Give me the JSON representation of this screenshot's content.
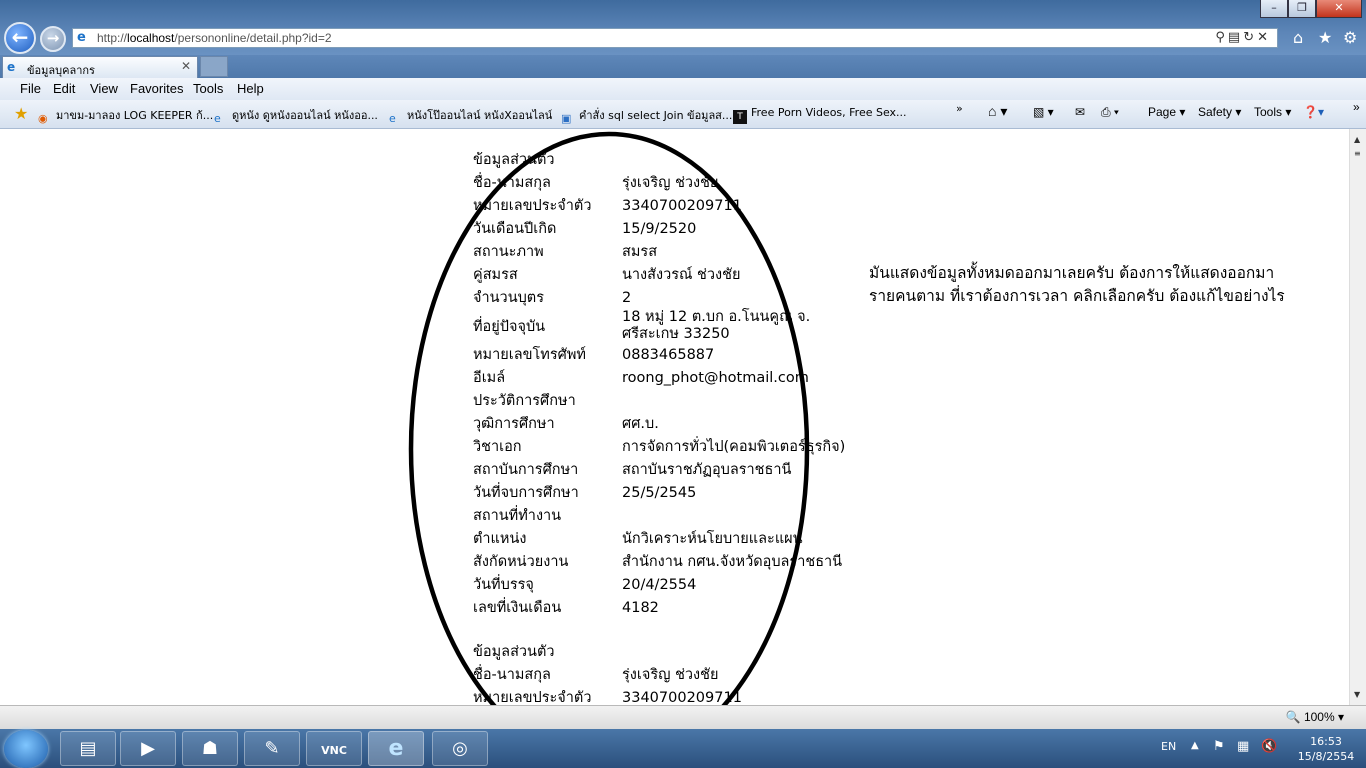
{
  "browser": {
    "url_prefix": "http://",
    "url_host": "localhost",
    "url_path": "/persononline/detail.php?id=2",
    "tab_title": "ข้อมูลบุคลากร",
    "window_controls": [
      "–",
      "❐",
      "✕"
    ]
  },
  "menu": [
    "File",
    "Edit",
    "View",
    "Favorites",
    "Tools",
    "Help"
  ],
  "favorites": [
    "มาขม-มาลอง LOG KEEPER ก้...",
    "ดูหนัง ดูหนังออนไลน์ หนังออ...",
    "หนังโป๊ออนไลน์ หนังXออนไลน์",
    "คำสั่ง sql select Join ข้อมูลส...",
    "Free Porn Videos, Free Sex..."
  ],
  "commands": {
    "page": "Page",
    "safety": "Safety",
    "tools": "Tools"
  },
  "record": [
    {
      "label": "ข้อมูลส่วนตัว",
      "value": ""
    },
    {
      "label": "ชื่อ-นามสกุล",
      "value": "รุ่งเจริญ  ช่วงชัย"
    },
    {
      "label": "หมายเลขประจำตัว",
      "value": "3340700209711"
    },
    {
      "label": "วันเดือนปีเกิด",
      "value": "15/9/2520"
    },
    {
      "label": "สถานะภาพ",
      "value": "สมรส"
    },
    {
      "label": "คู่สมรส",
      "value": "นางสังวรณ์ ช่วงชัย"
    },
    {
      "label": "จำนวนบุตร",
      "value": "2"
    },
    {
      "label": "ที่อยู่ปัจจุบัน",
      "value": "18 หมู่ 12 ต.บก อ.โนนคูณ จ.",
      "value2": "ศรีสะเกษ 33250"
    },
    {
      "label": "หมายเลขโทรศัพท์",
      "value": "0883465887"
    },
    {
      "label": "อีเมล์",
      "value": "roong_phot@hotmail.com"
    },
    {
      "label": "ประวัติการศึกษา",
      "value": ""
    },
    {
      "label": "วุฒิการศึกษา",
      "value": "ศศ.บ."
    },
    {
      "label": "วิชาเอก",
      "value": "การจัดการทั่วไป(คอมพิวเตอร์ธุรกิจ)"
    },
    {
      "label": "สถาบันการศึกษา",
      "value": "สถาบันราชภัฏอุบลราชธานี"
    },
    {
      "label": "วันที่จบการศึกษา",
      "value": "25/5/2545"
    },
    {
      "label": "สถานที่ทำงาน",
      "value": ""
    },
    {
      "label": "ตำแหน่ง",
      "value": "นักวิเคราะห์นโยบายและแผน"
    },
    {
      "label": "สังกัดหน่วยงาน",
      "value": "สำนักงาน กศน.จังหวัดอุบลราชธานี"
    },
    {
      "label": "วันที่บรรจุ",
      "value": "20/4/2554"
    },
    {
      "label": "เลขที่เงินเดือน",
      "value": "4182"
    }
  ],
  "record2": [
    {
      "label": "ข้อมูลส่วนตัว",
      "value": ""
    },
    {
      "label": "ชื่อ-นามสกุล",
      "value": "รุ่งเจริญ  ช่วงชัย"
    },
    {
      "label": "หมายเลขประจำตัว",
      "value": "3340700209711"
    }
  ],
  "note": {
    "line1": "มันแสดงข้อมูลทั้งหมดออกมาเลยครับ ต้องการให้แสดงออกมา",
    "line2": "รายคนตาม ที่เราต้องการเวลา คลิกเลือกครับ ต้องแก้ไขอย่างไร"
  },
  "status": {
    "zoom": "100%"
  },
  "taskbar": {
    "lang": "EN",
    "time": "16:53",
    "date": "15/8/2554"
  }
}
